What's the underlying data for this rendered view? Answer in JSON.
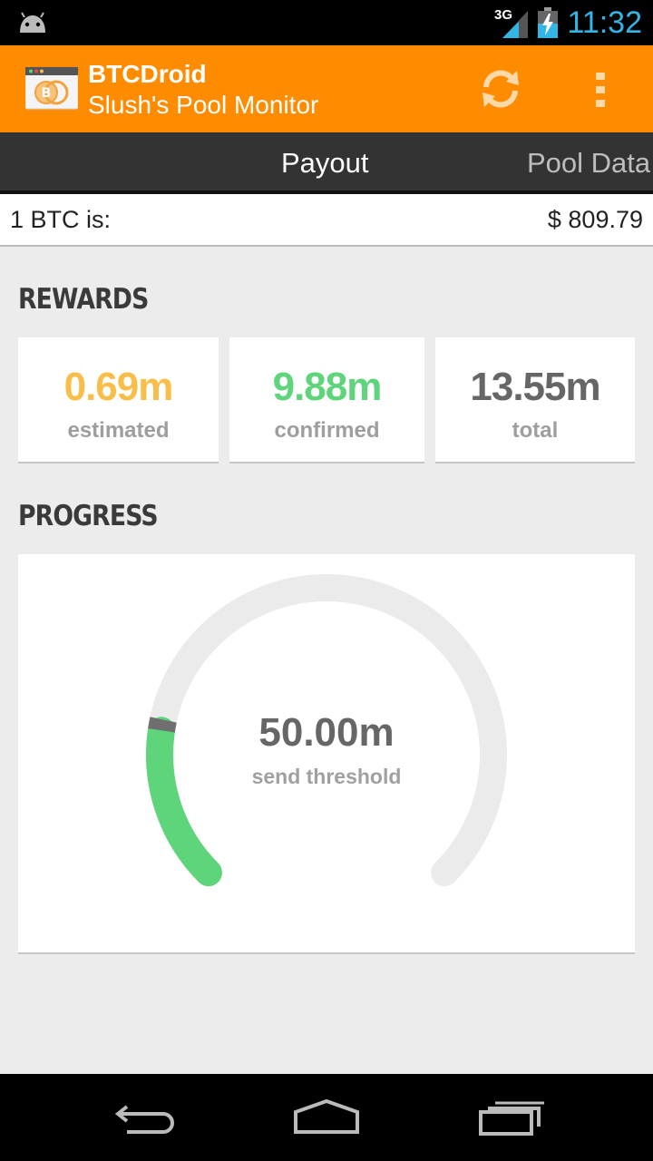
{
  "status_bar": {
    "network": "3G",
    "time": "11:32",
    "icons": [
      "android-icon",
      "signal-icon",
      "battery-charging-icon"
    ]
  },
  "action_bar": {
    "title": "BTCDroid",
    "subtitle": "Slush's Pool Monitor",
    "icons": [
      "app-logo-icon",
      "refresh-icon",
      "overflow-menu-icon"
    ],
    "color": "#ff8c00"
  },
  "tabs": [
    {
      "label": "Payout",
      "active": true
    },
    {
      "label": "Pool Data",
      "active": false
    }
  ],
  "price": {
    "label": "1 BTC is:",
    "value": "$ 809.79"
  },
  "rewards": {
    "header": "REWARDS",
    "cards": [
      {
        "value": "0.69m",
        "label": "estimated",
        "color": "#f9be4a"
      },
      {
        "value": "9.88m",
        "label": "confirmed",
        "color": "#5ed57a"
      },
      {
        "value": "13.55m",
        "label": "total",
        "color": "#666666"
      }
    ]
  },
  "progress": {
    "header": "PROGRESS",
    "value": "50.00m",
    "label": "send threshold",
    "confirmed_fraction": 0.1976,
    "estimated_fraction": 0.0138,
    "colors": {
      "track": "#ebebeb",
      "confirmed": "#5ed57a",
      "estimated": "#6f6f6f"
    }
  },
  "nav_bar": {
    "icons": [
      "back-icon",
      "home-icon",
      "recent-apps-icon"
    ]
  }
}
